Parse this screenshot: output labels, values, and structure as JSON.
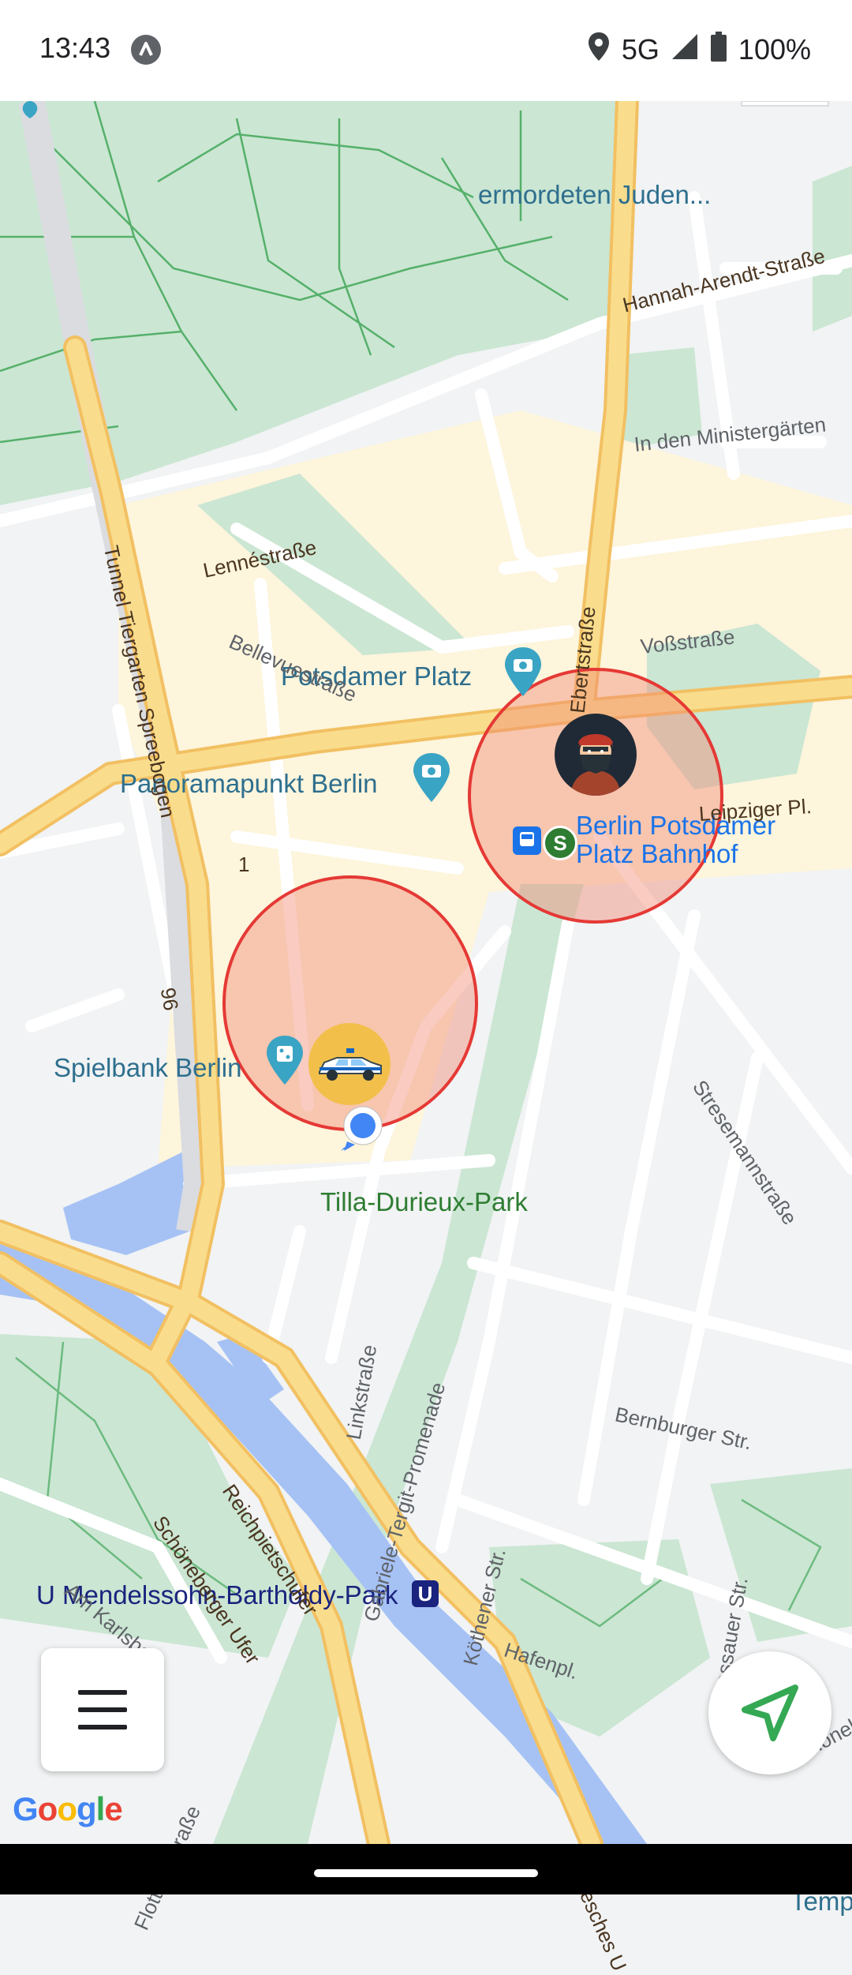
{
  "status_bar": {
    "time": "13:43",
    "network": "5G",
    "battery": "100%",
    "icons": [
      "app-notification-icon",
      "location-icon",
      "signal-icon",
      "battery-icon"
    ]
  },
  "map": {
    "labels": {
      "potsdamer_platz": "Potsdamer Platz",
      "panoramapunkt": "Panoramapunkt Berlin",
      "berlin_potsdamer_bahnhof": "Berlin Potsdamer\nPlatz Bahnhof",
      "spielbank": "Spielbank Berlin",
      "tilla_park": "Tilla-Durieux-Park",
      "u_mendelssohn": "U Mendelssohn-Bartholdy-Park",
      "top_cut": "ermordeten Juden...",
      "tempel_cut": "Temp",
      "u_badge": "U",
      "s_badge": "S"
    },
    "streets": {
      "hannah": "Hannah-Arendt-Straße",
      "ministergarten": "In den Ministergärten",
      "lenne": "Lennéstraße",
      "tunnel": "Tunnel Tiergarten Spreebogen",
      "bellevue": "Bellevuestraße",
      "ebert": "Ebertstraße",
      "voss": "Voßstraße",
      "leipziger": "Leipziger Pl.",
      "route1": "1",
      "route96": "96",
      "stresemann": "Stresemannstraße",
      "link": "Linkstraße",
      "gabriele": "Gabriele-Tergit-Promenade",
      "bernburger": "Bernburger Str.",
      "reichpietsch": "Reichpietschufer",
      "schoeneberger": "Schöneberger Ufer",
      "karlsbad": "Am Karlsbad",
      "koethener": "Köthener Str.",
      "hafen": "Hafenpl.",
      "dessauer": "Dessauer Str.",
      "flottwell": "Flottwellstraße",
      "hallesches": "Hallesches U",
      "schoene_cut": "Schöneb"
    },
    "markers": [
      "police-car-marker",
      "thief-avatar-marker",
      "user-location-marker"
    ]
  },
  "controls": {
    "menu_icon": "hamburger-menu-icon",
    "navigate_icon": "navigation-arrow-icon"
  },
  "attribution": {
    "google": "Google"
  },
  "colors": {
    "park": "#cbe6d3",
    "water": "#a6c2f5",
    "road_major": "#f9dd8d",
    "zone_fill": "#f7b5a5",
    "zone_stroke": "#e53935",
    "accent_nav": "#34a853"
  }
}
